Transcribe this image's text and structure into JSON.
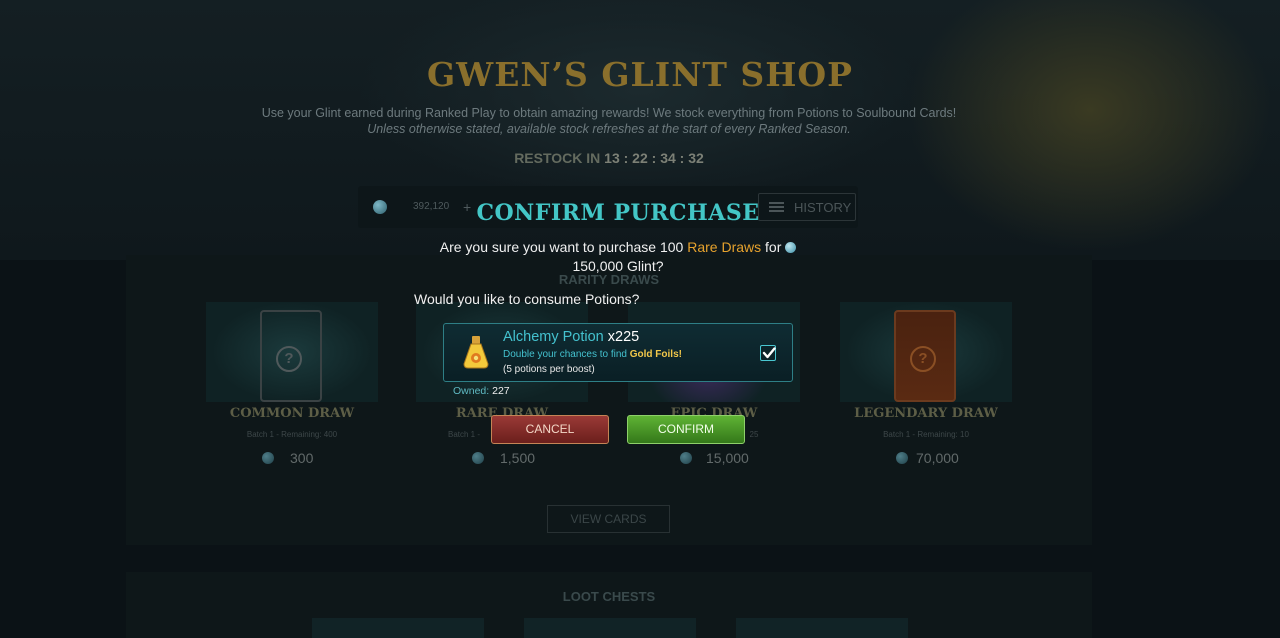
{
  "shop": {
    "title": "GWEN’S GLINT SHOP",
    "intro_line1": "Use your Glint earned during Ranked Play to obtain amazing rewards! We stock everything from Potions to Soulbound Cards!",
    "intro_line2": "Unless otherwise stated, available stock refreshes at the start of every Ranked Season.",
    "restock_label": "RESTOCK IN",
    "restock_time": "13 : 22 : 34 : 32",
    "balance": "392,120",
    "add_symbol": "+",
    "history_label": "HISTORY",
    "rarity_section": "RARITY DRAWS",
    "view_cards_label": "VIEW CARDS",
    "loot_section": "LOOT CHESTS",
    "cards": [
      {
        "name": "COMMON DRAW",
        "batch": "Batch 1 - Remaining: 400",
        "price": "300"
      },
      {
        "name": "RARE DRAW",
        "batch": "Batch 1 -",
        "price": "1,500"
      },
      {
        "name": "EPIC DRAW",
        "batch": "25",
        "price": "15,000"
      },
      {
        "name": "LEGENDARY DRAW",
        "batch": "Batch 1 - Remaining: 10",
        "price": "70,000"
      }
    ]
  },
  "modal": {
    "title": "CONFIRM PURCHASE",
    "question_pre": "Are you sure you want to purchase 100",
    "question_item": "Rare Draws",
    "question_for": "for",
    "question_amount": "150,000 Glint?",
    "consume_question": "Would you like to consume Potions?",
    "potion": {
      "name": "Alchemy Potion",
      "quantity": "x225",
      "desc_pre": "Double your chances to find",
      "desc_highlight": "Gold Foils!",
      "rule": "(5 potions per boost)",
      "checked": true,
      "owned_label": "Owned:",
      "owned_value": "227"
    },
    "cancel_label": "CANCEL",
    "confirm_label": "CONFIRM"
  },
  "colors": {
    "accent": "#43c6c6",
    "gold": "#e6a22d",
    "cancel": "#8a2f2b",
    "confirm": "#4f9f28"
  }
}
